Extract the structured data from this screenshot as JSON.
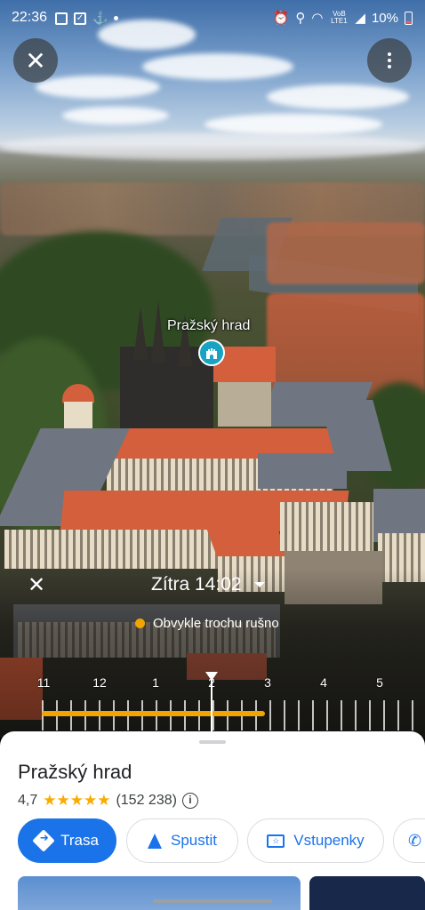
{
  "status_bar": {
    "time": "22:36",
    "carrier": "VoB LTE1",
    "battery": "10%",
    "icons": [
      "image-icon",
      "check-icon",
      "anchor-icon",
      "dot-icon",
      "alarm-icon",
      "location-icon",
      "wifi-icon",
      "signal-icon",
      "battery-icon"
    ]
  },
  "map": {
    "close_icon": "close-icon",
    "more_icon": "more-vert-icon",
    "place_label": "Pražský hrad",
    "place_pin_icon": "castle-icon"
  },
  "busyness": {
    "close_icon": "close-icon",
    "selected_time": "Zítra 14:02",
    "status": "Obvykle trochu rušno",
    "hour_labels": [
      "11",
      "12",
      "1",
      "2",
      "3",
      "4",
      "5"
    ],
    "current_hour_fraction": 0.5,
    "colors": {
      "busy": "#f2a400"
    }
  },
  "place": {
    "name": "Pražský hrad",
    "rating": "4,7",
    "stars": "★★★★★",
    "reviews": "(152 238)",
    "info_icon": "info-icon"
  },
  "actions": [
    {
      "label": "Trasa",
      "icon": "directions-icon",
      "primary": true
    },
    {
      "label": "Spustit",
      "icon": "navigation-icon",
      "primary": false
    },
    {
      "label": "Vstupenky",
      "icon": "ticket-icon",
      "primary": false
    },
    {
      "label": "",
      "icon": "phone-icon",
      "primary": false
    }
  ],
  "colors": {
    "accent": "#1a73e8",
    "star": "#f9ab00",
    "pin": "#19a3c2"
  }
}
